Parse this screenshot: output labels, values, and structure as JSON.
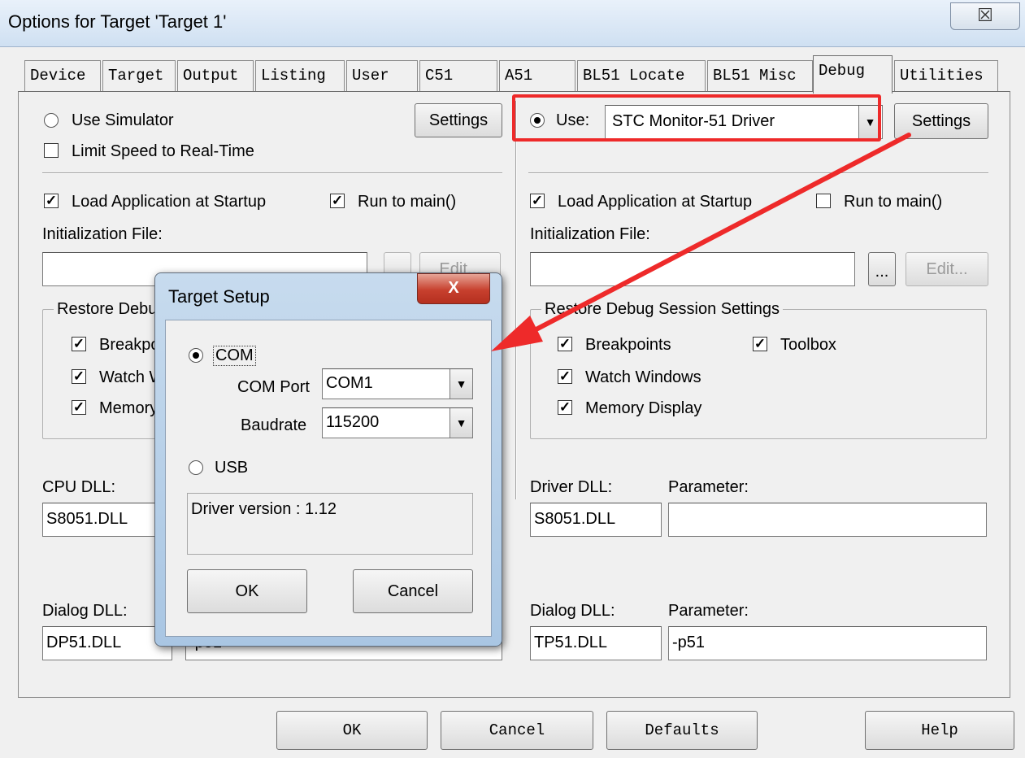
{
  "window": {
    "title": "Options for Target 'Target 1'",
    "close_glyph": "☒"
  },
  "tabs": [
    {
      "label": "Device",
      "active": false
    },
    {
      "label": "Target",
      "active": false
    },
    {
      "label": "Output",
      "active": false
    },
    {
      "label": "Listing",
      "active": false
    },
    {
      "label": "User",
      "active": false
    },
    {
      "label": "C51",
      "active": false
    },
    {
      "label": "A51",
      "active": false
    },
    {
      "label": "BL51 Locate",
      "active": false
    },
    {
      "label": "BL51 Misc",
      "active": false
    },
    {
      "label": "Debug",
      "active": true
    },
    {
      "label": "Utilities",
      "active": false
    }
  ],
  "left": {
    "use_simulator": {
      "label": "Use Simulator",
      "checked": false
    },
    "limit_speed": {
      "label": "Limit Speed to Real-Time",
      "checked": false
    },
    "settings_label": "Settings",
    "load_app": {
      "label": "Load Application at Startup",
      "checked": true
    },
    "run_to_main": {
      "label": "Run to main()",
      "checked": true
    },
    "init_file_label": "Initialization File:",
    "init_file_value": "",
    "edit_label": "Edit...",
    "restore_group": "Restore Debug Session Settings",
    "restore_items": [
      "Breakpoints",
      "Watch Windows",
      "Memory Display"
    ],
    "cpu_dll_label": "CPU DLL:",
    "cpu_dll_value": "S8051.DLL",
    "dialog_dll_label": "Dialog DLL:",
    "dialog_dll_value": "DP51.DLL",
    "dialog_param_value": "-p51"
  },
  "right": {
    "use_label": "Use:",
    "driver": "STC Monitor-51 Driver",
    "settings_label": "Settings",
    "load_app": {
      "label": "Load Application at Startup",
      "checked": true
    },
    "run_to_main": {
      "label": "Run to main()",
      "checked": false
    },
    "init_file_label": "Initialization File:",
    "init_file_value": "",
    "browse_label": "...",
    "edit_label": "Edit...",
    "restore_group": "Restore Debug Session Settings",
    "breakpoints": "Breakpoints",
    "toolbox": "Toolbox",
    "watch_windows": "Watch Windows",
    "memory_display": "Memory Display",
    "driver_dll_label": "Driver DLL:",
    "driver_dll_value": "S8051.DLL",
    "parameter_label": "Parameter:",
    "driver_param_value": "",
    "dialog_dll_label": "Dialog DLL:",
    "dialog_dll_value": "TP51.DLL",
    "dialog_param_label": "Parameter:",
    "dialog_param_value": "-p51"
  },
  "bottom_buttons": {
    "ok": "OK",
    "cancel": "Cancel",
    "defaults": "Defaults",
    "help": "Help"
  },
  "dialog": {
    "title": "Target Setup",
    "close_glyph": "X",
    "com_label": "COM",
    "com_selected": true,
    "com_port_label": "COM Port",
    "com_port_value": "COM1",
    "baudrate_label": "Baudrate",
    "baudrate_value": "115200",
    "usb_label": "USB",
    "usb_selected": false,
    "driver_version": "Driver version : 1.12",
    "ok": "OK",
    "cancel": "Cancel"
  },
  "icons": {
    "dropdown_arrow": "▼",
    "check_mark": "✓"
  },
  "colors": {
    "annotation_red": "#ee2a2a",
    "titlebar": "#cfe0f2",
    "dialog_close": "#c7402e"
  }
}
